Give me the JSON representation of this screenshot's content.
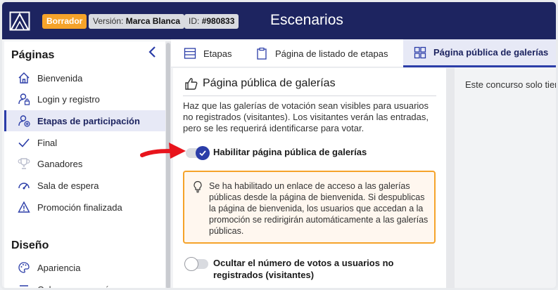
{
  "header": {
    "status_badge": "Borrador",
    "version_label": "Versión:",
    "version_value": "Marca Blanca",
    "id_label": "ID:",
    "id_value": "#980833",
    "title": "Escenarios"
  },
  "sidebar": {
    "section_pages": "Páginas",
    "items": [
      {
        "label": "Bienvenida",
        "icon": "home-icon"
      },
      {
        "label": "Login y registro",
        "icon": "user-lock-icon"
      },
      {
        "label": "Etapas de participación",
        "icon": "user-add-icon"
      },
      {
        "label": "Final",
        "icon": "check-icon"
      },
      {
        "label": "Ganadores",
        "icon": "trophy-icon"
      },
      {
        "label": "Sala de espera",
        "icon": "gauge-icon"
      },
      {
        "label": "Promoción finalizada",
        "icon": "warning-icon"
      }
    ],
    "section_design": "Diseño",
    "design_items": [
      {
        "label": "Apariencia",
        "icon": "palette-icon"
      },
      {
        "label": "Cabecera y menú",
        "icon": "menu-icon"
      }
    ]
  },
  "tabs": [
    {
      "label": "Etapas",
      "icon": "list-icon"
    },
    {
      "label": "Página de listado de etapas",
      "icon": "clipboard-icon"
    },
    {
      "label": "Página pública de galerías",
      "icon": "grid-icon"
    }
  ],
  "panel": {
    "title": "Página pública de galerías",
    "description": "Haz que las galerías de votación sean visibles para usuarios no registrados (visitantes). Los visitantes verán las entradas, pero se les requerirá identificarse para votar.",
    "toggle_public_label": "Habilitar página pública de galerías",
    "toggle_public_on": true,
    "note_text": "Se ha habilitado un enlace de acceso a las galerías públicas desde la página de bienvenida. Si despublicas la página de bienvenida, los usuarios que accedan a la promoción se redirigirán automáticamente a las galerías públicas.",
    "toggle_votes_label": "Ocultar el número de votos a usuarios no registrados (visitantes)",
    "toggle_votes_on": false
  },
  "right_panel": {
    "text": "Este concurso solo tiene una etapa de participación."
  },
  "colors": {
    "topbar": "#1d2460",
    "accent": "#2b3da8",
    "warning": "#f5a32a",
    "arrow": "#e8141c"
  }
}
